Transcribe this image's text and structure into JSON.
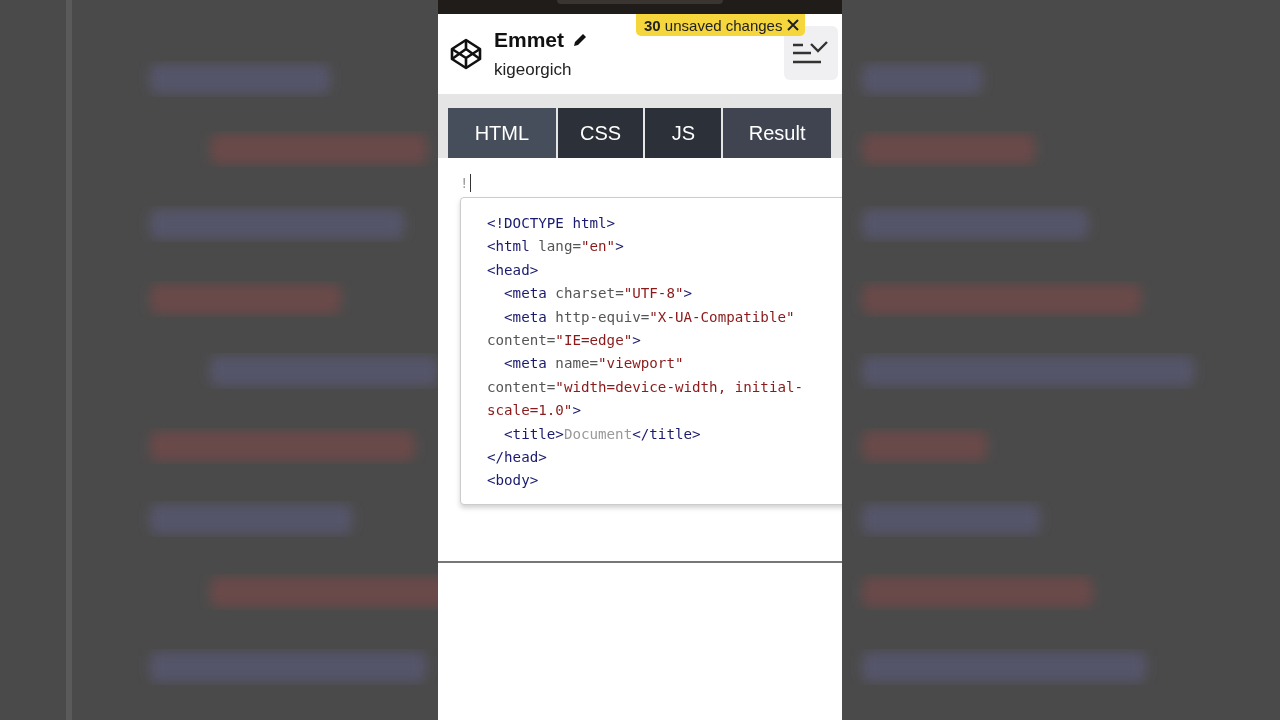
{
  "project": {
    "title": "Emmet",
    "author": "kigeorgich"
  },
  "unsaved_badge": {
    "count": "30",
    "label": "unsaved changes"
  },
  "tabs": [
    {
      "label": "HTML",
      "selected": true,
      "kind": "editor"
    },
    {
      "label": "CSS",
      "selected": false,
      "kind": "editor"
    },
    {
      "label": "JS",
      "selected": false,
      "kind": "editor"
    },
    {
      "label": "Result",
      "selected": false,
      "kind": "result"
    }
  ],
  "editor": {
    "typed": "!",
    "suggestion_lines": [
      [
        {
          "t": "<!DOCTYPE html>",
          "kind": "tag"
        }
      ],
      [
        {
          "t": "<html",
          "kind": "tag"
        },
        {
          "t": " lang=",
          "kind": "attr"
        },
        {
          "t": "\"en\"",
          "kind": "str"
        },
        {
          "t": ">",
          "kind": "tag"
        }
      ],
      [
        {
          "t": "<head>",
          "kind": "tag"
        }
      ],
      [
        {
          "t": "  <meta",
          "kind": "tag"
        },
        {
          "t": " charset=",
          "kind": "attr"
        },
        {
          "t": "\"UTF-8\"",
          "kind": "str"
        },
        {
          "t": ">",
          "kind": "tag"
        }
      ],
      [
        {
          "t": "  <meta",
          "kind": "tag"
        },
        {
          "t": " http-equiv=",
          "kind": "attr"
        },
        {
          "t": "\"X-UA-Compatible\"",
          "kind": "str"
        }
      ],
      [
        {
          "t": "content=",
          "kind": "attr"
        },
        {
          "t": "\"IE=edge\"",
          "kind": "str"
        },
        {
          "t": ">",
          "kind": "tag"
        }
      ],
      [
        {
          "t": "  <meta",
          "kind": "tag"
        },
        {
          "t": " name=",
          "kind": "attr"
        },
        {
          "t": "\"viewport\"",
          "kind": "str"
        }
      ],
      [
        {
          "t": "content=",
          "kind": "attr"
        },
        {
          "t": "\"width=device-width, initial-",
          "kind": "str"
        }
      ],
      [
        {
          "t": "scale=1.0\"",
          "kind": "str"
        },
        {
          "t": ">",
          "kind": "tag"
        }
      ],
      [
        {
          "t": "  <title>",
          "kind": "tag"
        },
        {
          "t": "Document",
          "kind": "text"
        },
        {
          "t": "</title>",
          "kind": "tag"
        }
      ],
      [
        {
          "t": "</head>",
          "kind": "tag"
        }
      ],
      [
        {
          "t": "<body>",
          "kind": "tag"
        }
      ]
    ]
  }
}
